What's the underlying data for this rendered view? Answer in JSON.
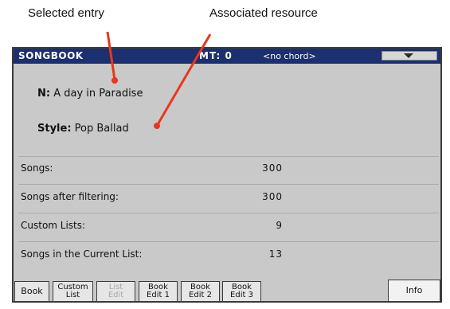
{
  "callouts": {
    "selected_entry": "Selected entry",
    "associated_resource": "Associated resource"
  },
  "titlebar": {
    "title": "SONGBOOK",
    "mt": "MT: 0",
    "chord": "<no chord>"
  },
  "entry": {
    "name_label": "N:",
    "name_value": "A day in Paradise",
    "style_label": "Style:",
    "style_value": "Pop Ballad"
  },
  "stats": [
    {
      "label": "Songs:",
      "value": "300"
    },
    {
      "label": "Songs after filtering:",
      "value": "300"
    },
    {
      "label": "Custom Lists:",
      "value": "9"
    },
    {
      "label": "Songs in the Current List:",
      "value": "13"
    }
  ],
  "tabs": [
    {
      "label": "Book",
      "state": "normal"
    },
    {
      "label": "Custom\nList",
      "state": "normal"
    },
    {
      "label": "List\nEdit",
      "state": "disabled"
    },
    {
      "label": "Book\nEdit 1",
      "state": "normal"
    },
    {
      "label": "Book\nEdit 2",
      "state": "normal"
    },
    {
      "label": "Book\nEdit 3",
      "state": "normal"
    },
    {
      "label": "Info",
      "state": "active"
    }
  ],
  "colors": {
    "titlebar": "#1c2f6e",
    "panel": "#c9c9c9",
    "callout_line": "#e8371f"
  }
}
